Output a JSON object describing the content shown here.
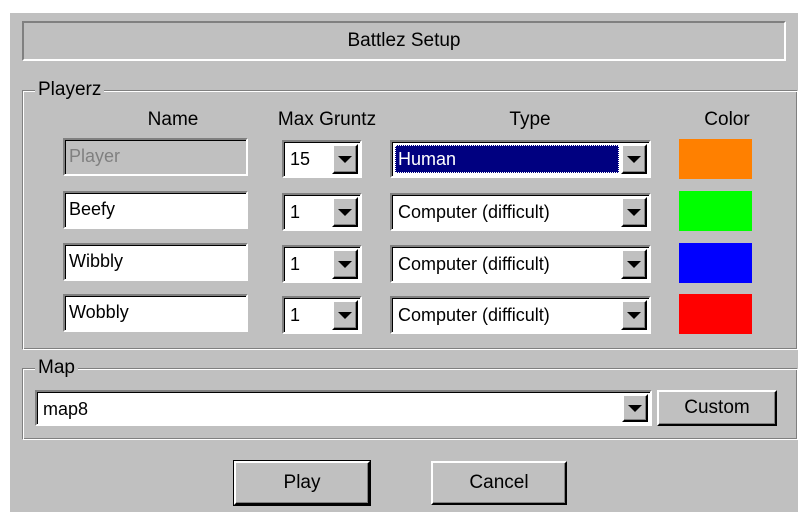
{
  "title": "Battlez Setup",
  "playerz_group": {
    "legend": "Playerz",
    "headers": {
      "name": "Name",
      "max_gruntz": "Max Gruntz",
      "type": "Type",
      "color": "Color"
    },
    "rows": [
      {
        "name": "Player",
        "name_disabled": true,
        "max_gruntz": "15",
        "type": "Human",
        "type_selected": true,
        "color": "#ff8000"
      },
      {
        "name": "Beefy",
        "name_disabled": false,
        "max_gruntz": "1",
        "type": "Computer (difficult)",
        "type_selected": false,
        "color": "#00ff00"
      },
      {
        "name": "Wibbly",
        "name_disabled": false,
        "max_gruntz": "1",
        "type": "Computer (difficult)",
        "type_selected": false,
        "color": "#0000ff"
      },
      {
        "name": "Wobbly",
        "name_disabled": false,
        "max_gruntz": "1",
        "type": "Computer (difficult)",
        "type_selected": false,
        "color": "#ff0000"
      }
    ]
  },
  "map_group": {
    "legend": "Map",
    "selected_map": "map8",
    "custom_label": "Custom"
  },
  "buttons": {
    "play": "Play",
    "cancel": "Cancel"
  }
}
